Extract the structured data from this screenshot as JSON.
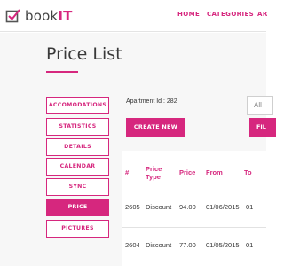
{
  "app": {
    "logo_text_prefix": "book",
    "logo_text_suffix": "IT",
    "logo_icon": "checkbox-icon",
    "accent_color": "#d6277e"
  },
  "nav": {
    "items": [
      "HOME",
      "CATEGORIES",
      "AR"
    ]
  },
  "page": {
    "title": "Price List"
  },
  "sidebar": {
    "items": [
      {
        "label": "ACCOMODATIONS",
        "active": false
      },
      {
        "label": "STATISTICS",
        "active": false
      },
      {
        "label": "DETAILS",
        "active": false
      },
      {
        "label": "CALENDAR",
        "active": false
      },
      {
        "label": "SYNC",
        "active": false
      },
      {
        "label": "PRICE",
        "active": true
      },
      {
        "label": "PICTURES",
        "active": false
      }
    ]
  },
  "main": {
    "apartment_id": "Apartment Id : 282",
    "create_button": "CREATE NEW",
    "filter_select_value": "All",
    "filter_button": "FIL"
  },
  "table": {
    "headers": [
      "#",
      "Price Type",
      "Price",
      "From",
      "To"
    ],
    "header_type_line1": "Price",
    "header_type_line2": "Type",
    "rows": [
      [
        "2605",
        "Discount",
        "94.00",
        "01/06/2015",
        "01"
      ],
      [
        "2604",
        "Discount",
        "77.00",
        "01/05/2015",
        "01"
      ]
    ]
  }
}
